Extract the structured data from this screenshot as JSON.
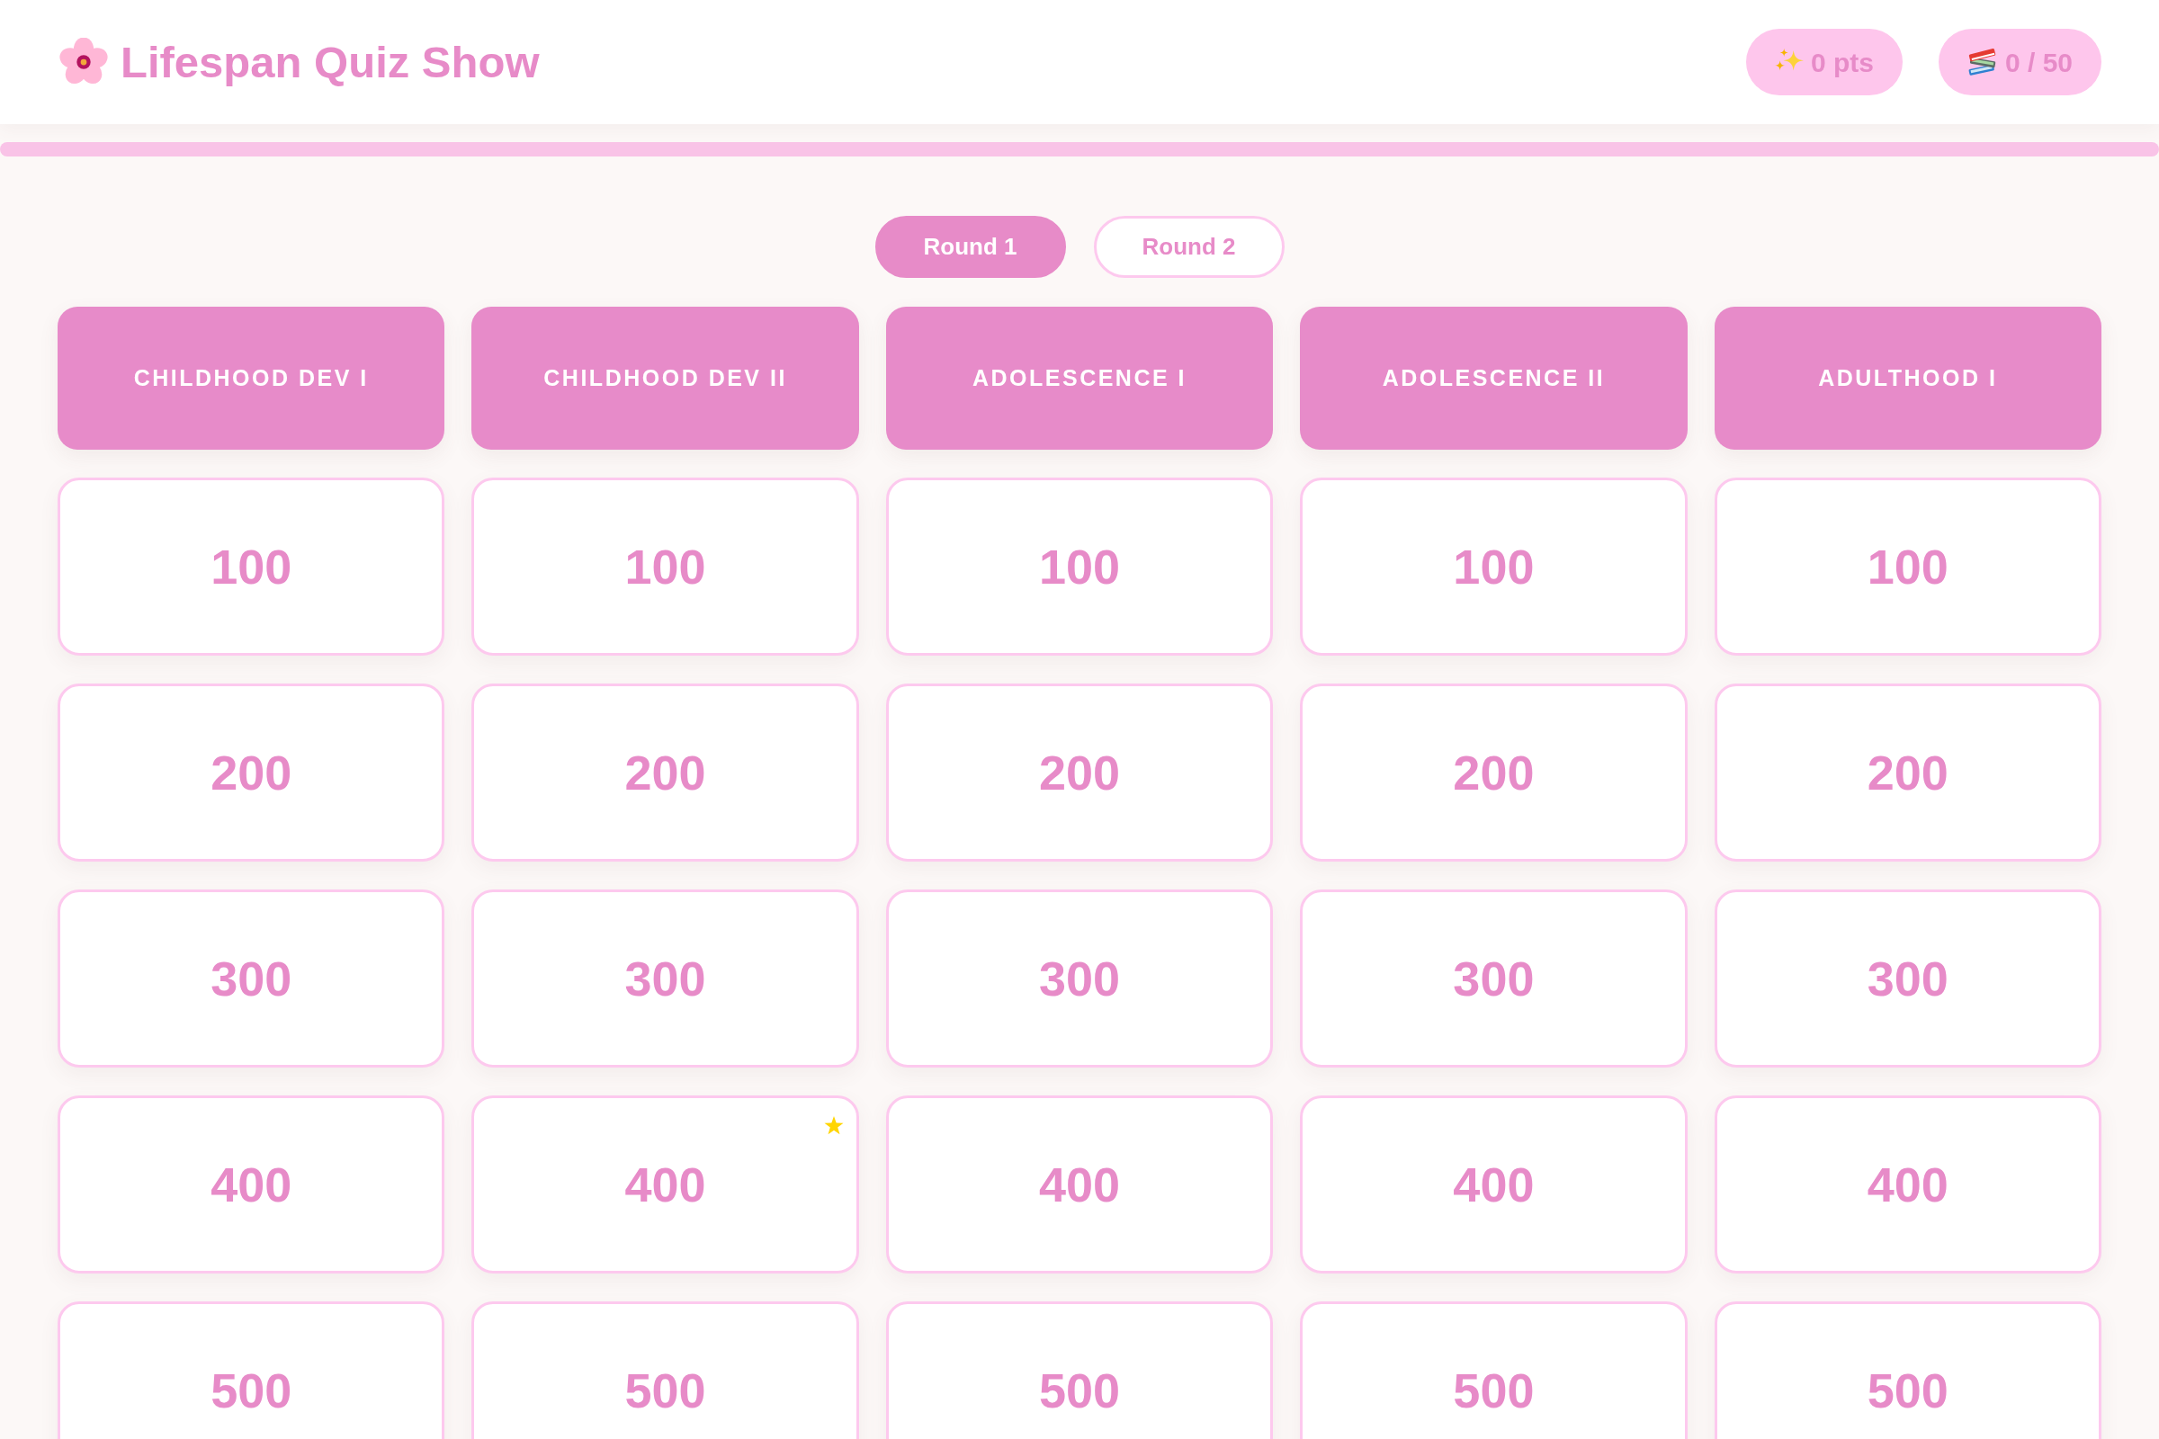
{
  "header": {
    "title": "Lifespan Quiz Show",
    "score": "0 pts",
    "answered": "0 / 50"
  },
  "progress": {
    "level": 0
  },
  "rounds": [
    {
      "label": "Round 1",
      "selected": true
    },
    {
      "label": "Round 2",
      "selected": false
    }
  ],
  "board": {
    "categories": [
      {
        "title": "CHILDHOOD DEV I",
        "tiles": [
          {
            "value": "100",
            "starred": false
          },
          {
            "value": "200",
            "starred": false
          },
          {
            "value": "300",
            "starred": false
          },
          {
            "value": "400",
            "starred": false
          },
          {
            "value": "500",
            "starred": false
          }
        ]
      },
      {
        "title": "CHILDHOOD DEV II",
        "tiles": [
          {
            "value": "100",
            "starred": false
          },
          {
            "value": "200",
            "starred": false
          },
          {
            "value": "300",
            "starred": false
          },
          {
            "value": "400",
            "starred": true
          },
          {
            "value": "500",
            "starred": false
          }
        ]
      },
      {
        "title": "ADOLESCENCE I",
        "tiles": [
          {
            "value": "100",
            "starred": false
          },
          {
            "value": "200",
            "starred": false
          },
          {
            "value": "300",
            "starred": false
          },
          {
            "value": "400",
            "starred": false
          },
          {
            "value": "500",
            "starred": false
          }
        ]
      },
      {
        "title": "ADOLESCENCE II",
        "tiles": [
          {
            "value": "100",
            "starred": false
          },
          {
            "value": "200",
            "starred": false
          },
          {
            "value": "300",
            "starred": false
          },
          {
            "value": "400",
            "starred": false
          },
          {
            "value": "500",
            "starred": false
          }
        ]
      },
      {
        "title": "ADULTHOOD I",
        "tiles": [
          {
            "value": "100",
            "starred": false
          },
          {
            "value": "200",
            "starred": false
          },
          {
            "value": "300",
            "starred": false
          },
          {
            "value": "400",
            "starred": false
          },
          {
            "value": "500",
            "starred": false
          }
        ]
      }
    ]
  }
}
